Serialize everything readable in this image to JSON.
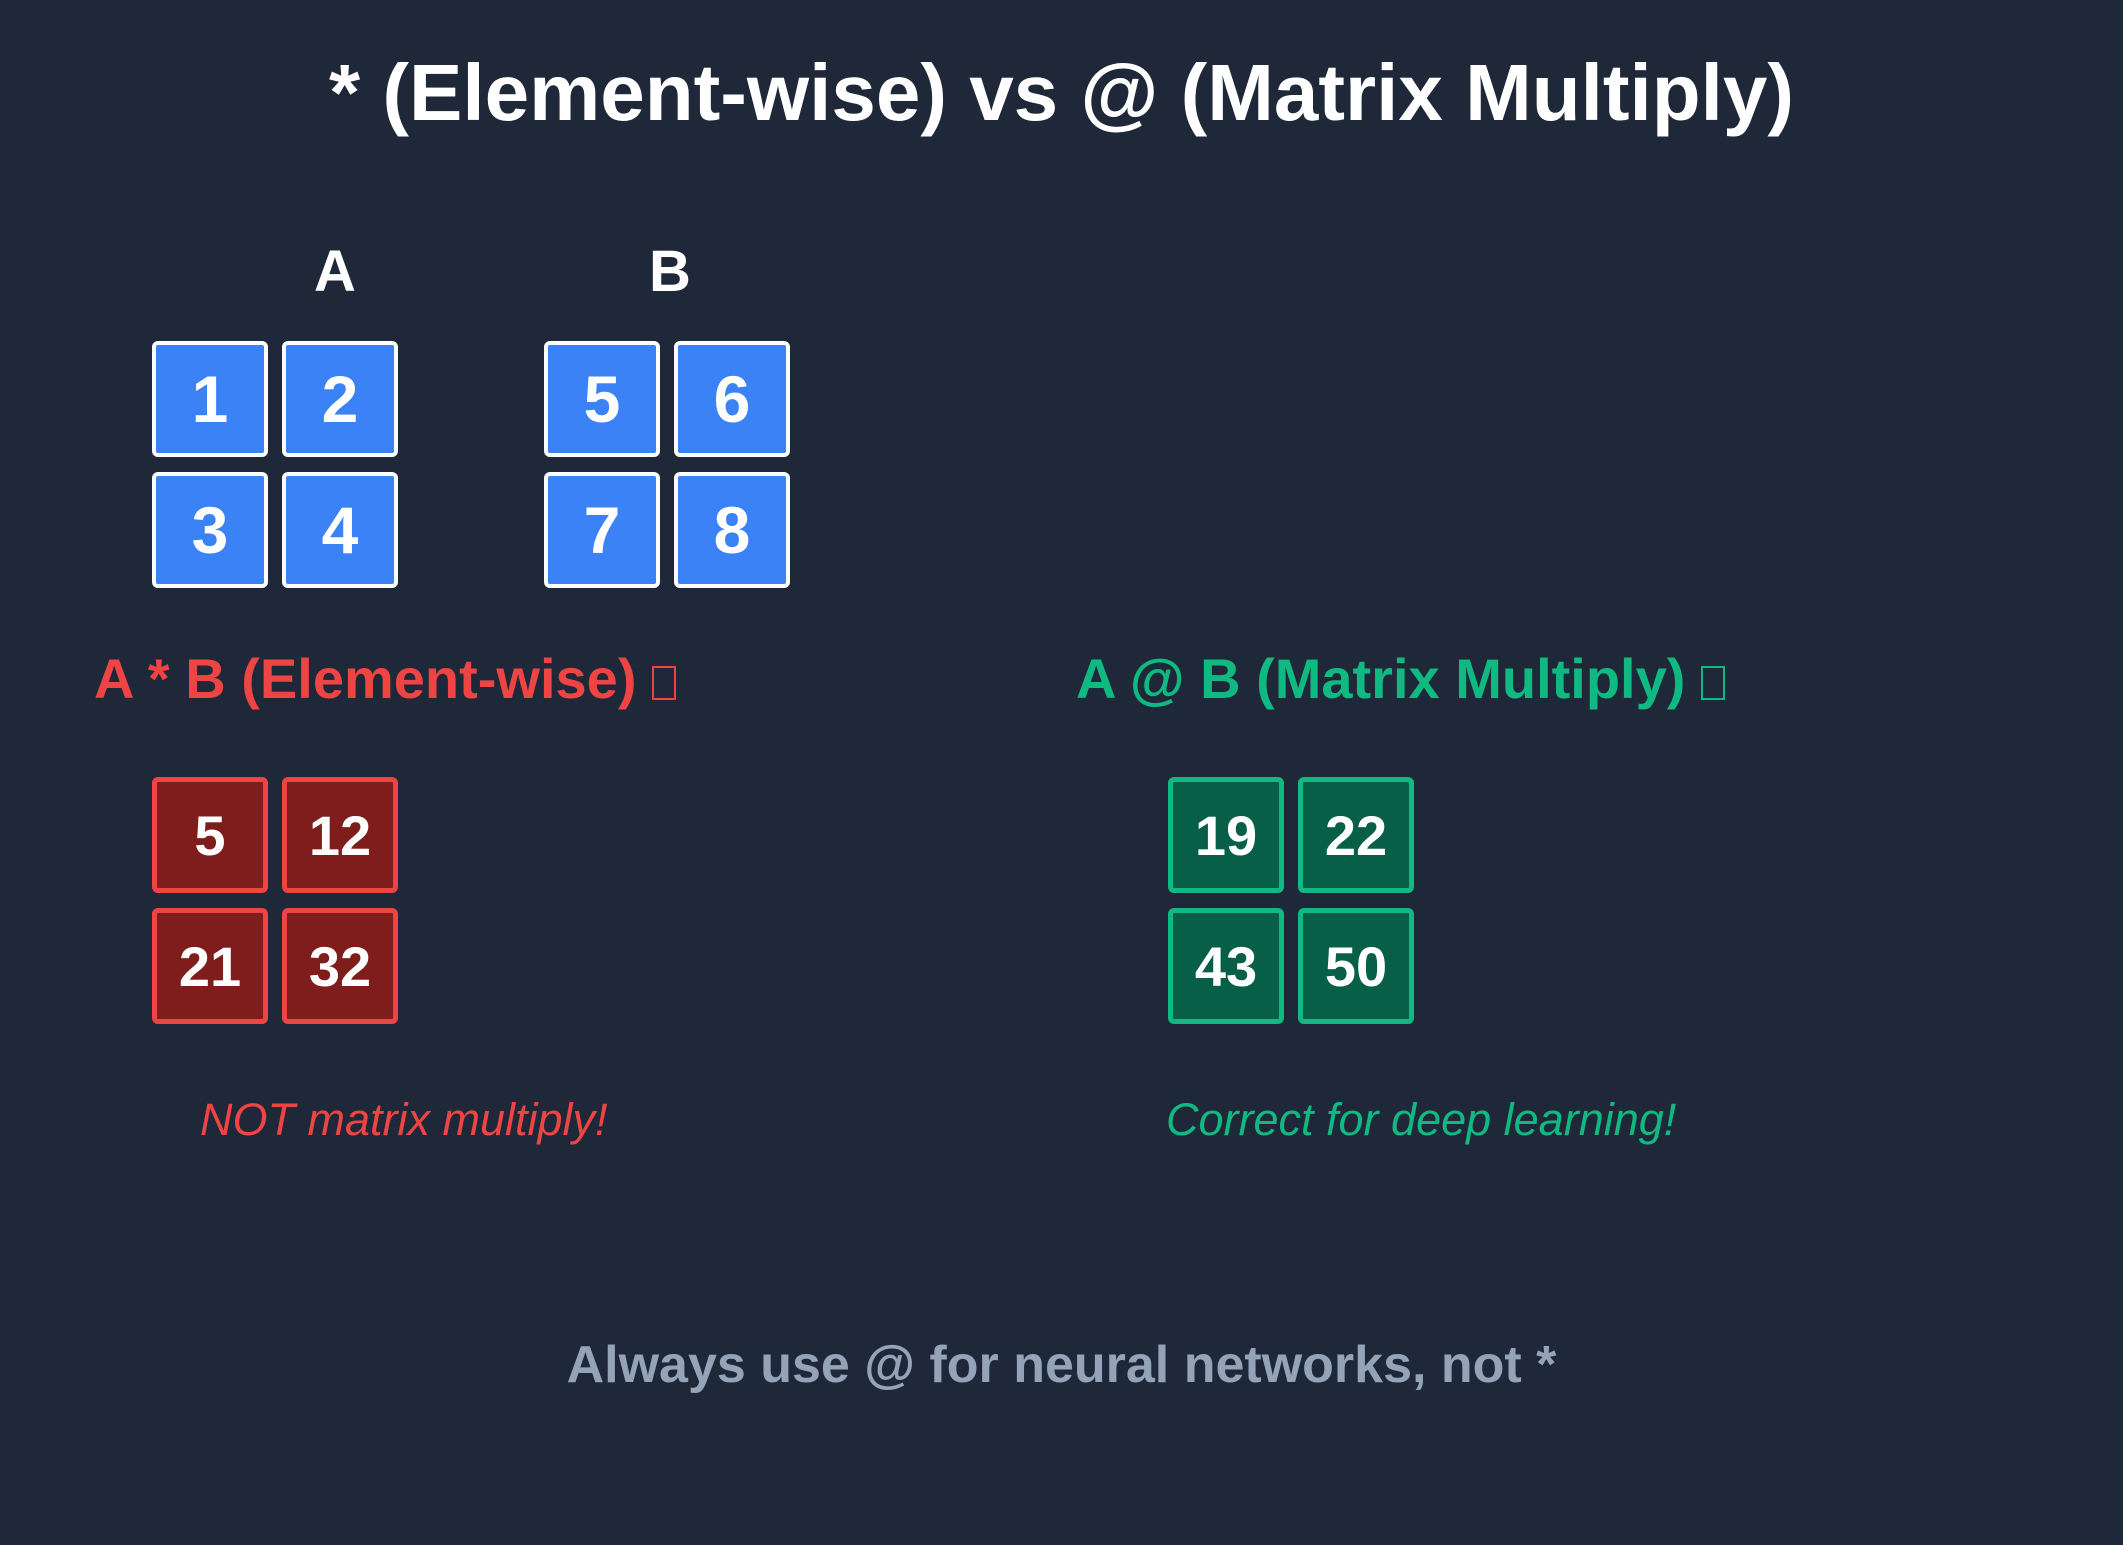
{
  "title": "* (Element-wise) vs @ (Matrix Multiply)",
  "matrix_a": {
    "label": "A",
    "cells": [
      "1",
      "2",
      "3",
      "4"
    ]
  },
  "matrix_b": {
    "label": "B",
    "cells": [
      "5",
      "6",
      "7",
      "8"
    ]
  },
  "elementwise": {
    "heading": "A * B (Element-wise)",
    "cells": [
      "5",
      "12",
      "21",
      "32"
    ],
    "note": "NOT matrix multiply!"
  },
  "matmul": {
    "heading": "A @ B (Matrix Multiply)",
    "cells": [
      "19",
      "22",
      "43",
      "50"
    ],
    "note": "Correct for deep learning!"
  },
  "footer": "Always use @ for neural networks, not *",
  "colors": {
    "background": "#1f2839",
    "input_cell": "#3b82f6",
    "wrong_accent": "#ef4444",
    "wrong_fill": "#7f1d1d",
    "right_accent": "#10b981",
    "right_fill": "#065f46",
    "footer_text": "#94a3b8"
  }
}
